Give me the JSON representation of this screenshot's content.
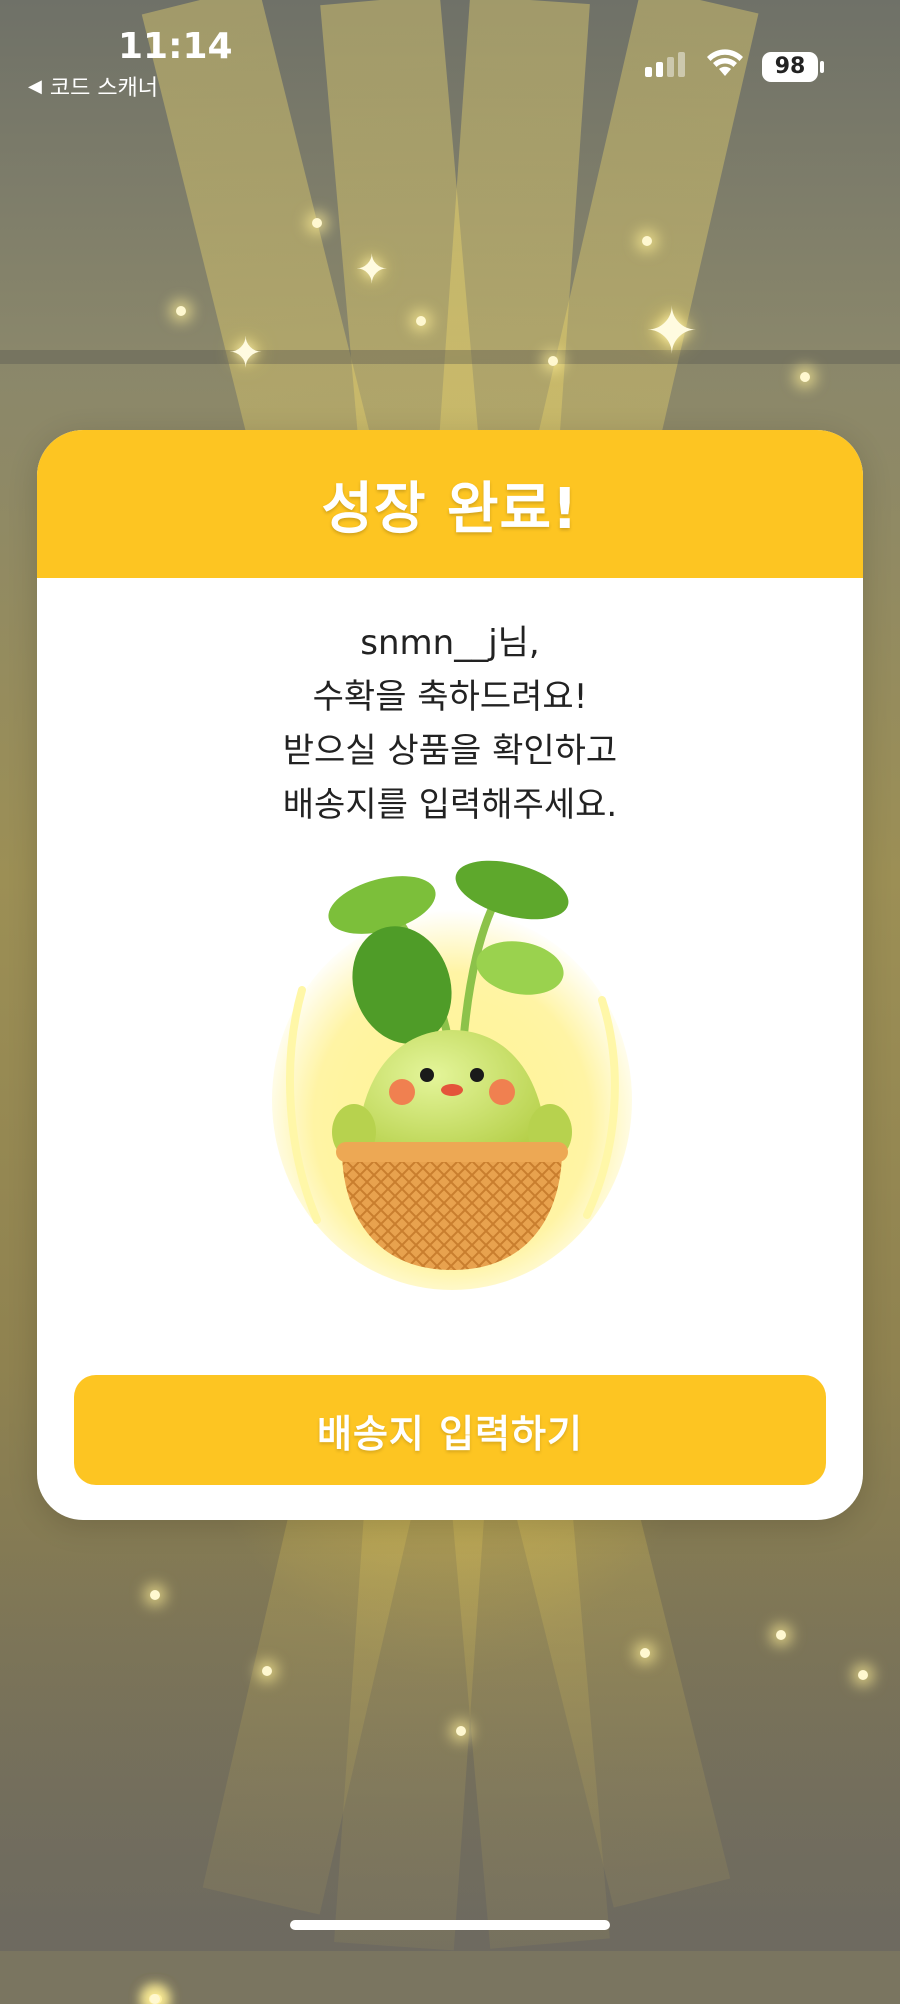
{
  "status_bar": {
    "time": "11:14",
    "back_label": "코드 스캐너",
    "battery_level": "98"
  },
  "modal": {
    "title": "성장 완료!",
    "message_lines": [
      "snmn__j님,",
      "수확을 축하드려요!",
      "받으실 상품을 확인하고",
      "배송지를 입력해주세요."
    ],
    "cta_label": "배송지 입력하기"
  },
  "colors": {
    "accent": "#fdc522",
    "text": "#222222"
  },
  "icons": [
    "back-arrow-icon",
    "signal-icon",
    "wifi-icon",
    "battery-icon",
    "plant-character-illustration"
  ]
}
